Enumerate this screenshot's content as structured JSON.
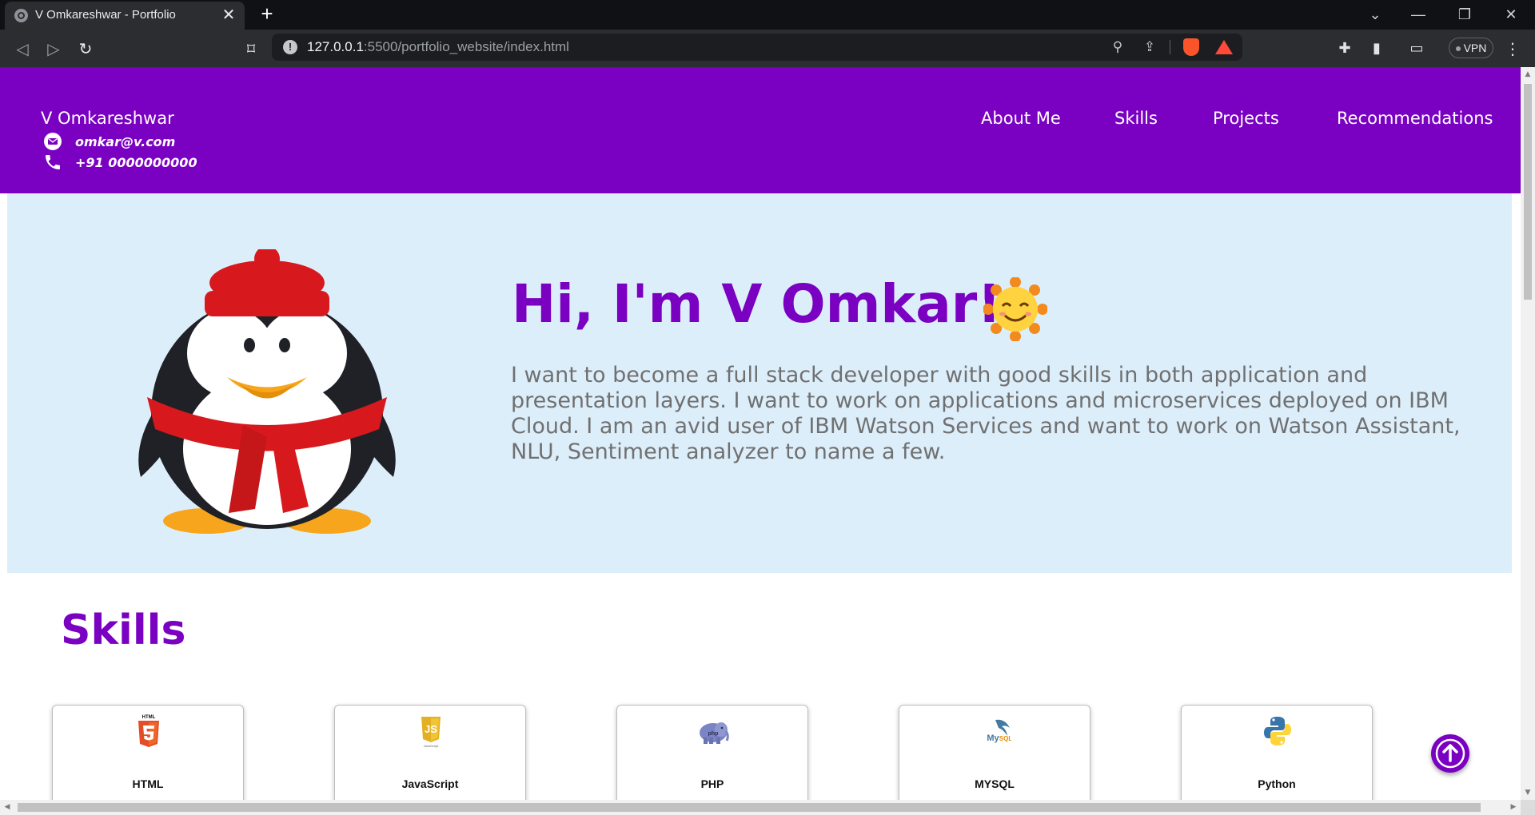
{
  "browser": {
    "tab_title": "V Omkareshwar - Portfolio",
    "url_host": "127.0.0.1",
    "url_path": ":5500/portfolio_website/index.html",
    "vpn_label": "VPN"
  },
  "header": {
    "name": "V Omkareshwar",
    "email": "omkar@v.com",
    "phone": "+91 0000000000",
    "nav": [
      "About Me",
      "Skills",
      "Projects",
      "Recommendations"
    ]
  },
  "hero": {
    "title": "Hi, I'm V Omkar!",
    "description": "I want to become a full stack developer with good skills in both application and presentation layers. I want to work on applications and microservices deployed on IBM Cloud. I am an avid user of IBM Watson Services and want to work on Watson Assistant, NLU, Sentiment analyzer to name a few."
  },
  "skills": {
    "title": "Skills",
    "items": [
      {
        "name": "HTML",
        "icon": "html5-icon"
      },
      {
        "name": "JavaScript",
        "icon": "javascript-icon"
      },
      {
        "name": "PHP",
        "icon": "php-elephant-icon"
      },
      {
        "name": "MYSQL",
        "icon": "mysql-icon"
      },
      {
        "name": "Python",
        "icon": "python-icon"
      }
    ]
  },
  "colors": {
    "brand_purple": "#7a00c2",
    "hero_bg": "#ddeefb"
  }
}
